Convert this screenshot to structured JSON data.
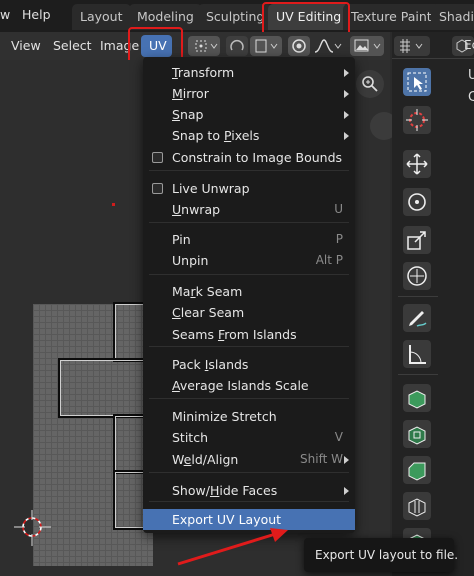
{
  "topbar": {
    "menus": [
      "w",
      "Help"
    ],
    "workspace_tabs": [
      {
        "label": "Layout"
      },
      {
        "label": "Modeling"
      },
      {
        "label": "Sculpting"
      },
      {
        "label": "UV Editing",
        "active": true
      },
      {
        "label": "Texture Paint"
      },
      {
        "label": "Shadin"
      }
    ]
  },
  "header": {
    "view_label": "View",
    "select_label": "Select",
    "image_label": "Image",
    "uv_label": "UV"
  },
  "uv_menu": {
    "items": [
      {
        "label": "Transform",
        "ul": 0,
        "submenu": true
      },
      {
        "label": "Mirror",
        "ul": 0,
        "submenu": true
      },
      {
        "label": "Snap",
        "ul": 0,
        "submenu": true
      },
      {
        "label": "Snap to Pixels",
        "ul": 8,
        "submenu": true
      },
      {
        "label": "Constrain to Image Bounds",
        "ul": -1,
        "checkbox": true
      },
      {
        "label": "Live Unwrap",
        "ul": -1,
        "checkbox": true
      },
      {
        "label": "Unwrap",
        "ul": 0,
        "shortcut": "U"
      },
      {
        "label": "Pin",
        "ul": -1,
        "shortcut": "P"
      },
      {
        "label": "Unpin",
        "ul": -1,
        "shortcut": "Alt P"
      },
      {
        "label": "Mark Seam",
        "ul": 2
      },
      {
        "label": "Clear Seam",
        "ul": 0
      },
      {
        "label": "Seams From Islands",
        "ul": 6
      },
      {
        "label": "Pack Islands",
        "ul": 5
      },
      {
        "label": "Average Islands Scale",
        "ul": 0
      },
      {
        "label": "Minimize Stretch",
        "ul": -1
      },
      {
        "label": "Stitch",
        "ul": -1,
        "shortcut": "V"
      },
      {
        "label": "Weld/Align",
        "ul": 1,
        "shortcut": "Shift W",
        "submenu": true
      },
      {
        "label": "Show/Hide Faces",
        "ul": 5,
        "submenu": true
      },
      {
        "label": "Export UV Layout",
        "ul": -1,
        "highlighted": true
      }
    ]
  },
  "tooltip": {
    "text": "Export UV layout to file."
  },
  "right_panel": {
    "partial_label": "Ec",
    "partial_letter_u": "U",
    "partial_letter_c": "C"
  },
  "colors": {
    "accent": "#4772b3",
    "annotation": "#e01b1b"
  }
}
